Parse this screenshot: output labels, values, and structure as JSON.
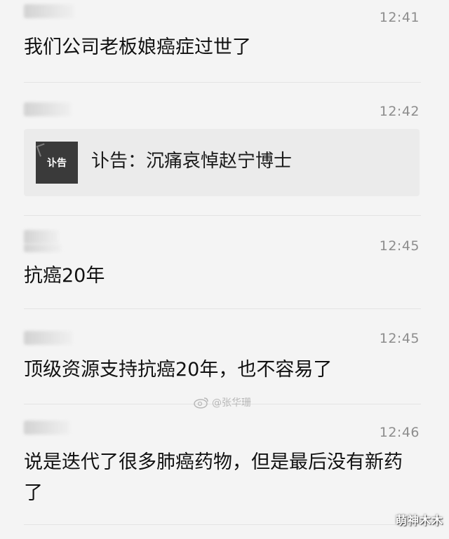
{
  "messages": [
    {
      "time": "12:41",
      "text": "我们公司老板娘癌症过世了"
    },
    {
      "time": "12:42",
      "card": {
        "thumb_label": "讣告",
        "title": "讣告：沉痛哀悼赵宁博士"
      }
    },
    {
      "time": "12:45",
      "text": "抗癌20年"
    },
    {
      "time": "12:45",
      "text": "顶级资源支持抗癌20年，也不容易了"
    },
    {
      "time": "12:46",
      "text": "说是迭代了很多肺癌药物，但是最后没有新药了"
    }
  ],
  "watermark": {
    "icon": "weibo-icon",
    "text": "@张华珊"
  },
  "corner_logo": {
    "text": "萌神木木"
  },
  "colors": {
    "background": "#f4f4f4",
    "card": "#ebebeb",
    "time": "#8d8d8d",
    "divider": "#e3e3e3"
  }
}
